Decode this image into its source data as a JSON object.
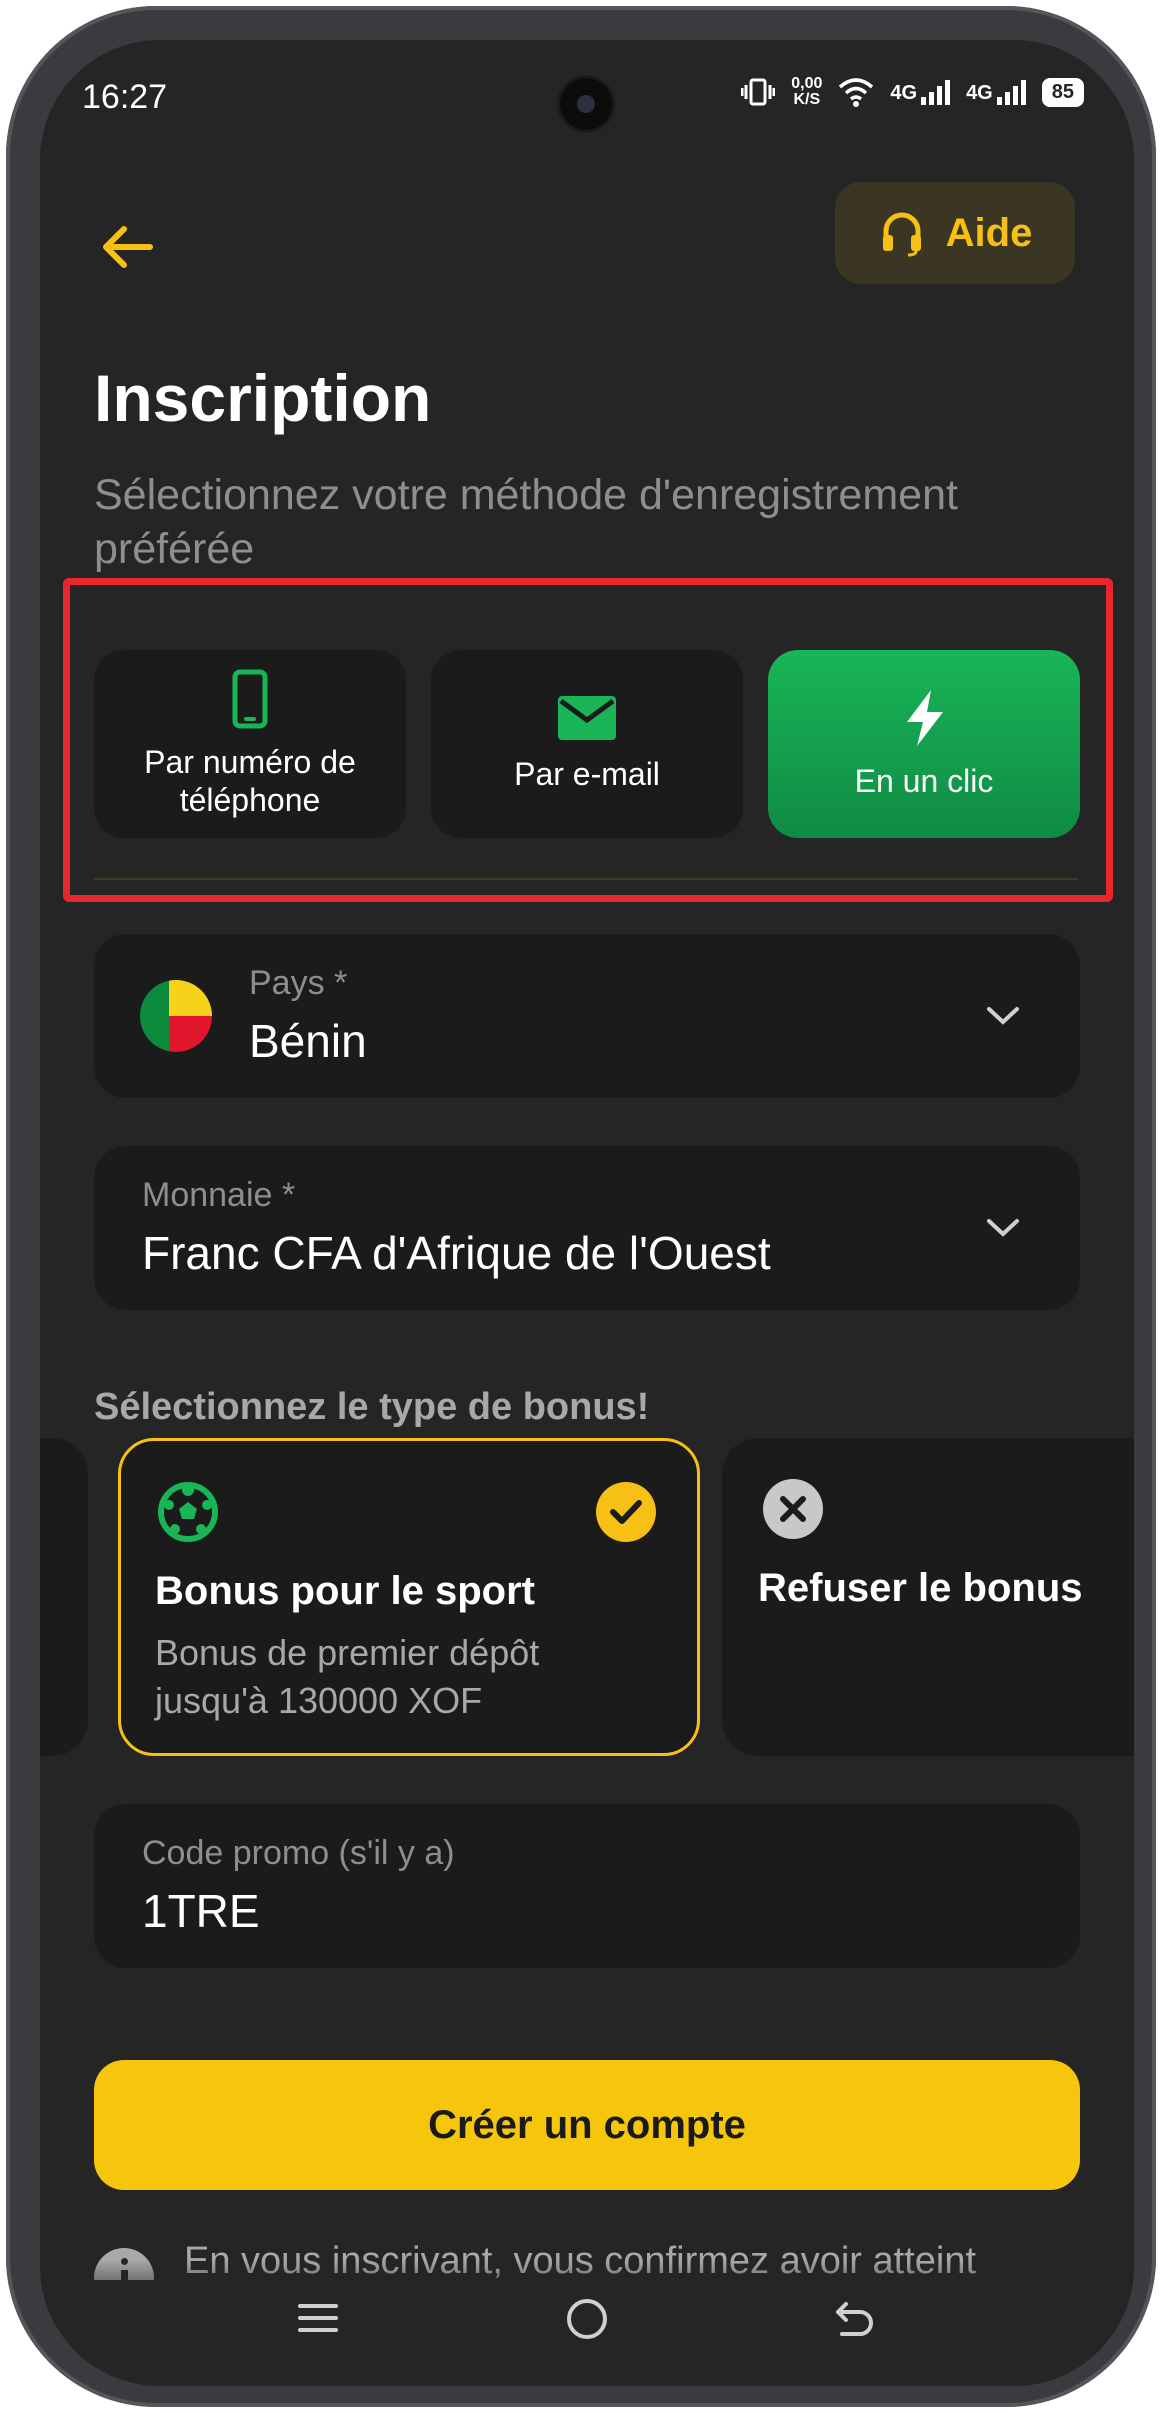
{
  "status_bar": {
    "time": "16:27",
    "speed_value": "0,00",
    "speed_unit": "K/S",
    "network_1": "4G",
    "network_2": "4G",
    "battery": "85"
  },
  "header": {
    "back_icon": "arrow-left-icon",
    "help_label": "Aide",
    "help_icon": "headset-icon"
  },
  "page": {
    "title": "Inscription",
    "subtitle": "Sélectionnez votre méthode d'enregistrement préférée"
  },
  "methods": [
    {
      "label": "Par numéro de téléphone",
      "icon": "phone-icon",
      "active": false
    },
    {
      "label": "Par e-mail",
      "icon": "envelope-icon",
      "active": false
    },
    {
      "label": "En un clic",
      "icon": "lightning-icon",
      "active": true
    }
  ],
  "country": {
    "label": "Pays *",
    "value": "Bénin"
  },
  "currency": {
    "label": "Monnaie *",
    "value": "Franc CFA d'Afrique de l'Ouest"
  },
  "bonus": {
    "section_title": "Sélectionnez le type de bonus!",
    "options": [
      {
        "title": "Bonus pour le sport",
        "description_line1": "Bonus de premier dépôt",
        "description_line2": "jusqu'à 130000 XOF",
        "icon": "soccer-ball-icon",
        "selected": true
      },
      {
        "title": "Refuser le bonus",
        "icon": "close-circle-icon",
        "selected": false
      }
    ]
  },
  "promo": {
    "label": "Code promo (s'il y a)",
    "value": "1TRE"
  },
  "create_button": "Créer un compte",
  "disclaimer": "En vous inscrivant, vous confirmez avoir atteint",
  "colors": {
    "accent": "#f6c014",
    "active_green": "#19b557",
    "highlight_red": "#e8262d",
    "background": "#252525",
    "card": "#1b1b1b"
  }
}
